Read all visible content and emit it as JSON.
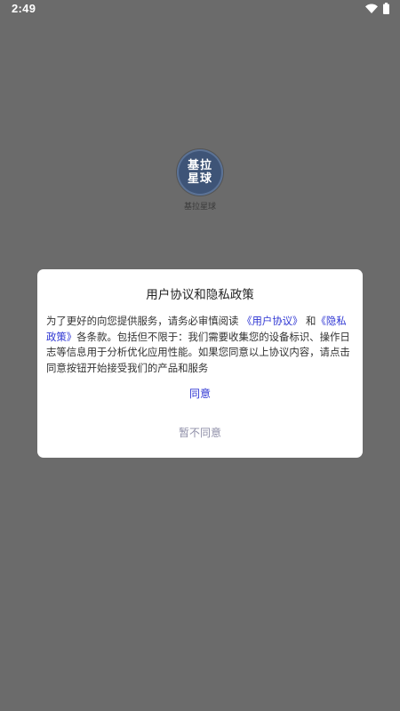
{
  "status_bar": {
    "time": "2:49"
  },
  "splash": {
    "logo_line1": "基拉",
    "logo_line2": "星球",
    "app_name": "基拉星球"
  },
  "dialog": {
    "title": "用户协议和隐私政策",
    "body_prefix": "为了更好的向您提供服务，请务必审慎阅读",
    "user_agreement_link": "《用户协议》",
    "and_text": "和",
    "privacy_policy_link": "《隐私政策》",
    "body_suffix": "各条款。包括但不限于：我们需要收集您的设备标识、操作日志等信息用于分析优化应用性能。如果您同意以上协议内容，请点击同意按钮开始接受我们的产品和服务",
    "agree_label": "同意",
    "disagree_label": "暂不同意"
  },
  "colors": {
    "overlay_background": "#6b6b6b",
    "link": "#2f36d3",
    "disagree": "#8f8fa8"
  },
  "icons": {
    "wifi": "wifi-icon",
    "battery": "battery-icon"
  }
}
